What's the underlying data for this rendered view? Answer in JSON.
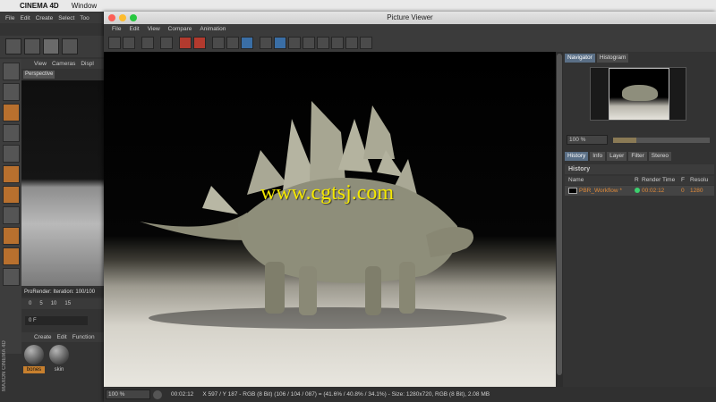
{
  "mac": {
    "app_name": "CINEMA 4D",
    "menu_window": "Window"
  },
  "c4d": {
    "menu": [
      "File",
      "Edit",
      "Create",
      "Select",
      "Too"
    ],
    "viewport_menu": [
      "View",
      "Cameras",
      "Displ"
    ],
    "viewport_label": "Perspective",
    "prorender_status": "ProRender: Iteration: 100/100",
    "timeline_ticks": [
      "0",
      "5",
      "10",
      "15"
    ],
    "frame_field": "0 F",
    "material_menu": [
      "Create",
      "Edit",
      "Function"
    ],
    "materials": [
      {
        "label": "bones"
      },
      {
        "label": "skin"
      }
    ],
    "brand": "MAXON CINEMA 4D"
  },
  "picture_viewer": {
    "title": "Picture Viewer",
    "menu": [
      "File",
      "Edit",
      "View",
      "Compare",
      "Animation"
    ],
    "watermark": "www.cgtsj.com",
    "status": {
      "zoom": "100 %",
      "time": "00:02:12",
      "info": "X 597 / Y 187 - RGB (8 Bit) (106 / 104 / 087) = (41.6% / 40.8% / 34.1%) - Size: 1280x720, RGB (8 Bit), 2.08 MB"
    },
    "navigator": {
      "tabs": [
        "Navigator",
        "Histogram"
      ],
      "zoom": "100 %",
      "zoom_level": 0.24
    },
    "history": {
      "tabs": [
        "History",
        "Info",
        "Layer",
        "Filter",
        "Stereo"
      ],
      "title": "History",
      "columns": [
        "Name",
        "R",
        "Render Time",
        "F",
        "Resolu"
      ],
      "rows": [
        {
          "name": "PBR_Workflow *",
          "time": "00:02:12",
          "frame": "0",
          "res": "1280"
        }
      ]
    },
    "colors": {
      "accent_orange": "#e08a3a",
      "active_tab": "#5a6f86",
      "watermark": "#f4e800"
    }
  }
}
